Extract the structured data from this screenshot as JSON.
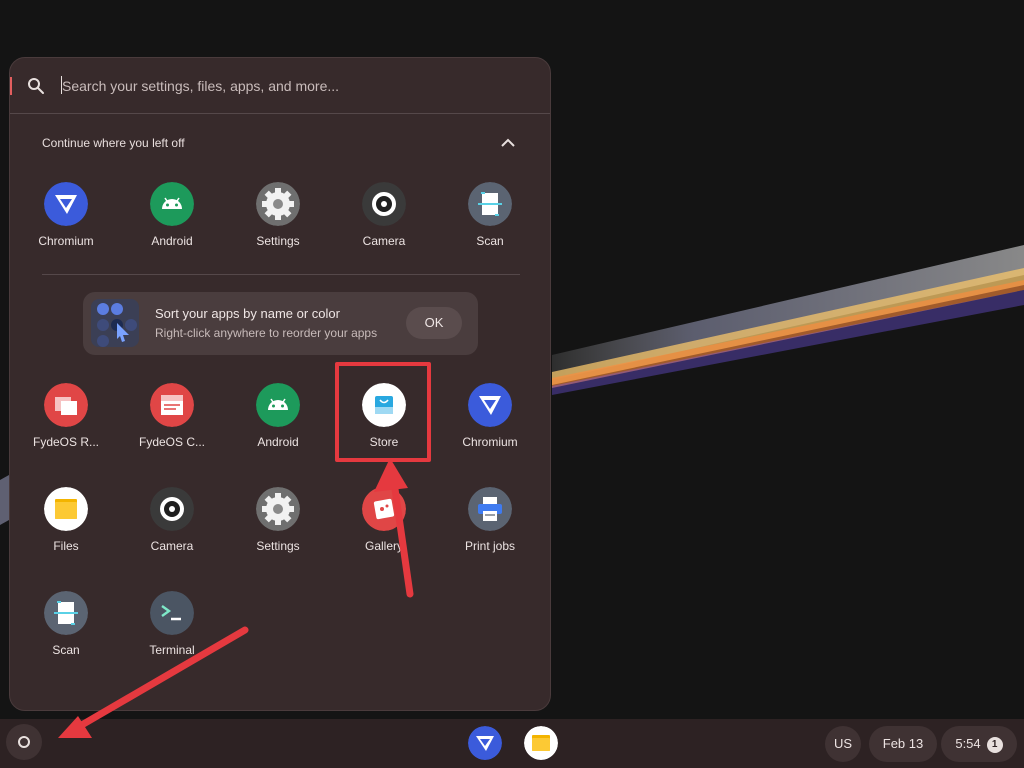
{
  "search": {
    "placeholder": "Search your settings, files, apps, and more..."
  },
  "continue_section": {
    "title": "Continue where you left off",
    "apps": [
      {
        "label": "Chromium",
        "icon": "chromium-icon"
      },
      {
        "label": "Android",
        "icon": "android-icon"
      },
      {
        "label": "Settings",
        "icon": "settings-gear-icon"
      },
      {
        "label": "Camera",
        "icon": "camera-icon"
      },
      {
        "label": "Scan",
        "icon": "scan-icon"
      }
    ]
  },
  "nudge": {
    "title": "Sort your apps by name or color",
    "subtitle": "Right-click anywhere to reorder your apps",
    "ok_label": "OK"
  },
  "apps_grid": [
    {
      "label": "FydeOS R...",
      "icon": "fydeos-remote-icon"
    },
    {
      "label": "FydeOS C...",
      "icon": "fydeos-connect-icon"
    },
    {
      "label": "Android",
      "icon": "android-icon"
    },
    {
      "label": "Store",
      "icon": "store-bag-icon"
    },
    {
      "label": "Chromium",
      "icon": "chromium-icon"
    },
    {
      "label": "Files",
      "icon": "files-folder-icon"
    },
    {
      "label": "Camera",
      "icon": "camera-icon"
    },
    {
      "label": "Settings",
      "icon": "settings-gear-icon"
    },
    {
      "label": "Gallery",
      "icon": "gallery-icon"
    },
    {
      "label": "Print jobs",
      "icon": "printer-icon"
    },
    {
      "label": "Scan",
      "icon": "scan-icon"
    },
    {
      "label": "Terminal",
      "icon": "terminal-icon"
    }
  ],
  "shelf": {
    "pinned": [
      {
        "name": "Chromium",
        "icon": "chromium-icon"
      },
      {
        "name": "Files",
        "icon": "files-folder-icon"
      }
    ],
    "ime_label": "US",
    "date": "Feb 13",
    "time": "5:54",
    "notification_count": "1"
  },
  "colors": {
    "launcher_bg": "#372a2b",
    "highlight": "#e5393f",
    "shelf_bg": "#2d2223"
  }
}
